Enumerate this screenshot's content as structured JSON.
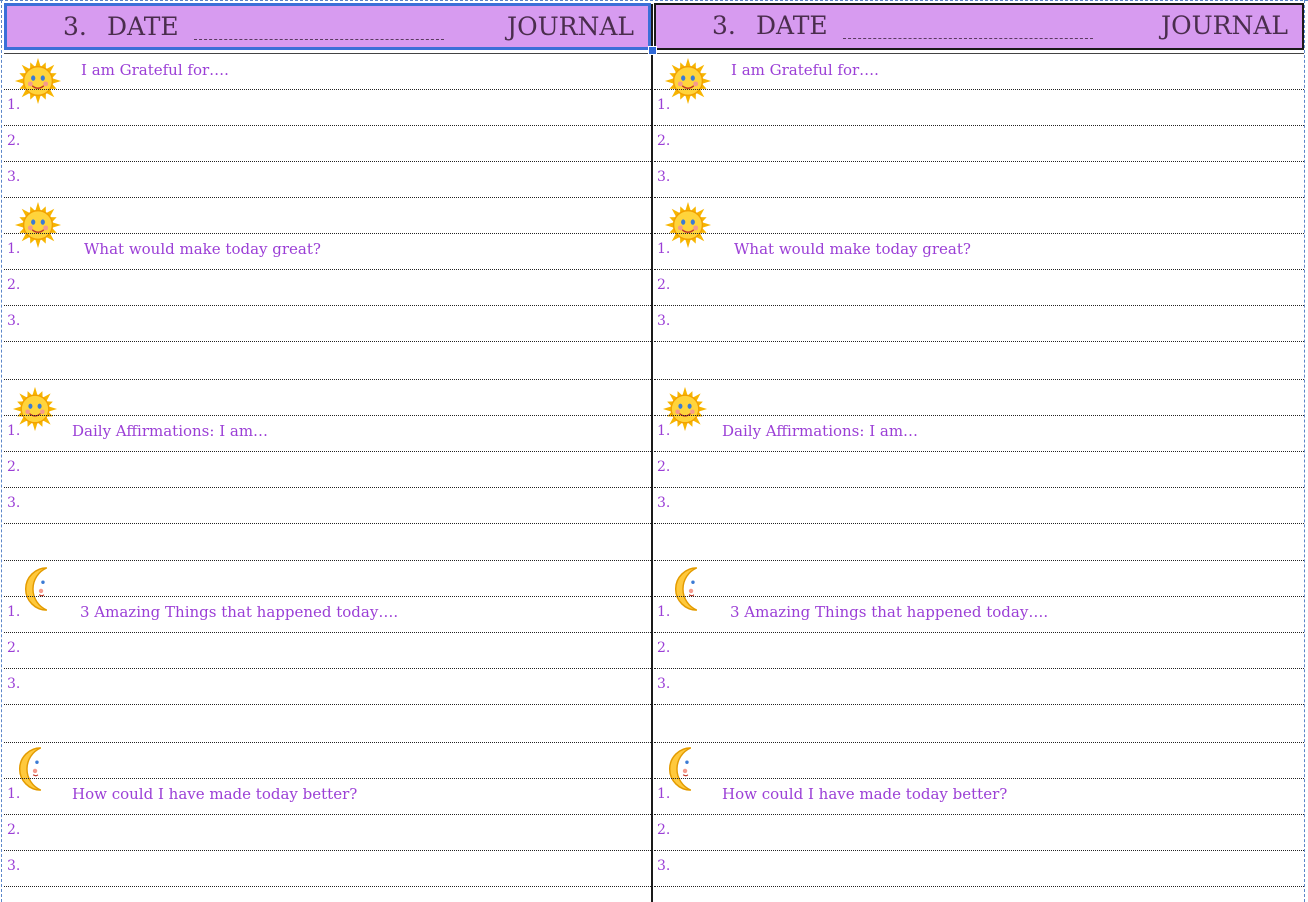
{
  "header": {
    "number": "3.",
    "date_label": "DATE",
    "journal_label": "JOURNAL"
  },
  "sections": [
    {
      "title": "I am Grateful for….",
      "icon": "sun-icon",
      "items": [
        "1.",
        "2.",
        "3."
      ]
    },
    {
      "title": "What would make today great?",
      "icon": "sun-icon",
      "items": [
        "1.",
        "2.",
        "3."
      ]
    },
    {
      "title": "Daily Affirmations: I am…",
      "icon": "sun-icon",
      "items": [
        "1.",
        "2.",
        "3."
      ]
    },
    {
      "title": "3 Amazing Things that happened today….",
      "icon": "moon-icon",
      "items": [
        "1.",
        "2.",
        "3."
      ]
    },
    {
      "title": "How could I have made today better?",
      "icon": "moon-icon",
      "items": [
        "1.",
        "2.",
        "3."
      ]
    }
  ],
  "colors": {
    "header_background": "#d79bf0",
    "text_purple": "#9b3fd6",
    "selection_blue": "#3b6fd8"
  }
}
